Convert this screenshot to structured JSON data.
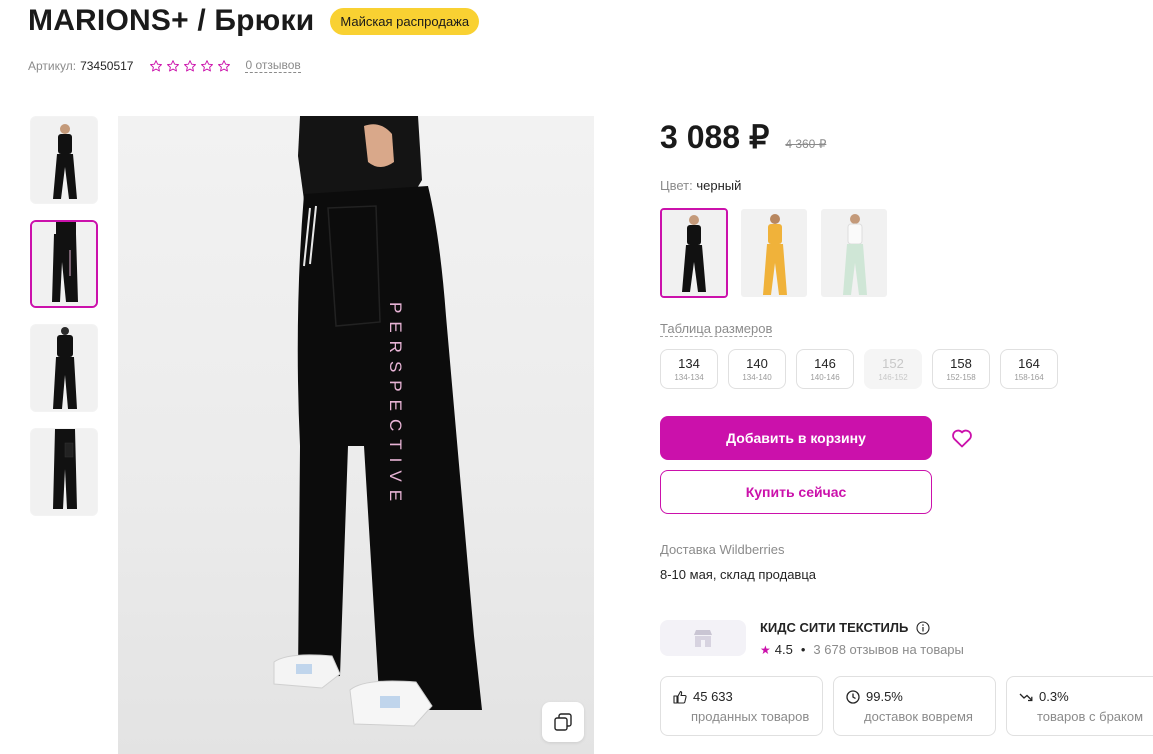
{
  "product": {
    "title": "MARIONS+ / Брюки",
    "promo_badge": "Майская распродажа",
    "article_label": "Артикул:",
    "article_value": "73450517",
    "reviews_link": "0 отзывов",
    "rating_stars": 0
  },
  "price": {
    "current": "3 088 ₽",
    "old": "4 360 ₽"
  },
  "color": {
    "label": "Цвет:",
    "value": "черный",
    "options": [
      "black",
      "yellow",
      "mint"
    ]
  },
  "sizes": {
    "table_link": "Таблица размеров",
    "items": [
      {
        "size": "134",
        "range": "134-134",
        "available": true
      },
      {
        "size": "140",
        "range": "134-140",
        "available": true
      },
      {
        "size": "146",
        "range": "140-146",
        "available": true
      },
      {
        "size": "152",
        "range": "146-152",
        "available": false
      },
      {
        "size": "158",
        "range": "152-158",
        "available": true
      },
      {
        "size": "164",
        "range": "158-164",
        "available": true
      }
    ]
  },
  "actions": {
    "add_to_cart": "Добавить в корзину",
    "buy_now": "Купить сейчас",
    "favorite_icon": "heart-icon"
  },
  "delivery": {
    "label": "Доставка Wildberries",
    "value": "8-10 мая, склад продавца"
  },
  "seller": {
    "name": "КИДС СИТИ ТЕКСТИЛЬ",
    "rating": "4.5",
    "reviews": "3 678 отзывов на товары"
  },
  "stats": [
    {
      "icon": "thumb-up-icon",
      "value": "45 633",
      "label": "проданных товаров"
    },
    {
      "icon": "clock-icon",
      "value": "99.5%",
      "label": "доставок вовремя"
    },
    {
      "icon": "trend-down-icon",
      "value": "0.3%",
      "label": "товаров с браком"
    }
  ],
  "colors": {
    "accent": "#cb11ab",
    "badge": "#f9d132"
  },
  "photo": {
    "print_text": "PERSPECTIVE"
  }
}
